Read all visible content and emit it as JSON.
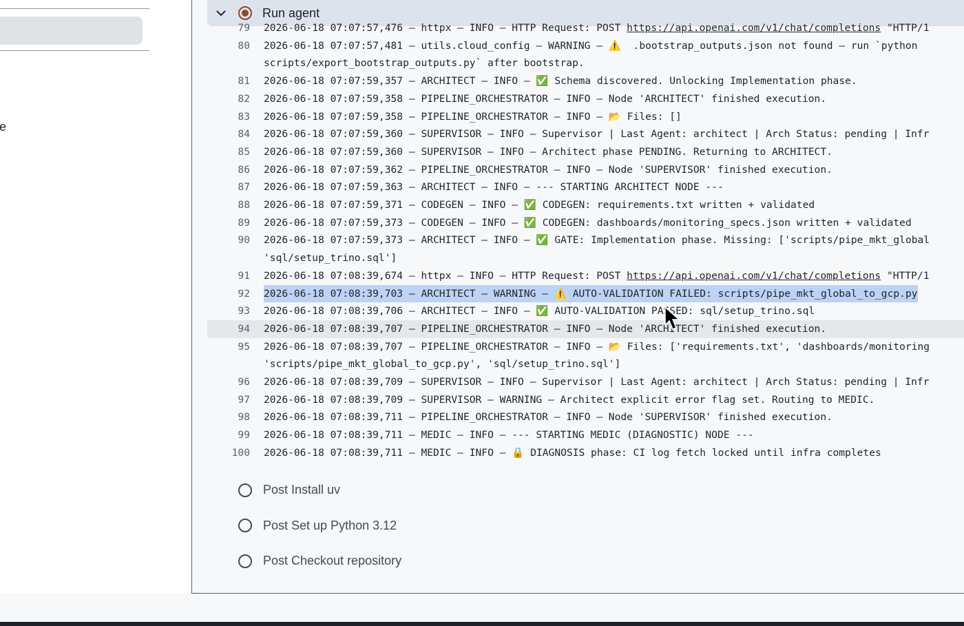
{
  "sidebar": {
    "fragment_text": "e"
  },
  "step": {
    "title": "Run agent",
    "status_icon": "running-icon",
    "chevron_icon": "chevron-down-icon"
  },
  "log": [
    {
      "n": "79",
      "parts": [
        {
          "t": "2026-06-18 07:07:57,476 – httpx – INFO – HTTP Request: POST "
        },
        {
          "t": "https://api.openai.com/v1/chat/completions",
          "link": true
        },
        {
          "t": " \"HTTP/1"
        }
      ]
    },
    {
      "n": "80",
      "parts": [
        {
          "t": "2026-06-18 07:07:57,481 – utils.cloud_config – WARNING – "
        },
        {
          "t": "⚠️",
          "emoji": true
        },
        {
          "t": "  .bootstrap_outputs.json not found – run `python"
        }
      ]
    },
    {
      "n": "",
      "wrap": true,
      "parts": [
        {
          "t": "scripts/export_bootstrap_outputs.py` after bootstrap."
        }
      ]
    },
    {
      "n": "81",
      "parts": [
        {
          "t": "2026-06-18 07:07:59,357 – ARCHITECT – INFO – "
        },
        {
          "t": "✅",
          "emoji": true
        },
        {
          "t": " Schema discovered. Unlocking Implementation phase."
        }
      ]
    },
    {
      "n": "82",
      "parts": [
        {
          "t": "2026-06-18 07:07:59,358 – PIPELINE_ORCHESTRATOR – INFO – Node 'ARCHITECT' finished execution."
        }
      ]
    },
    {
      "n": "83",
      "parts": [
        {
          "t": "2026-06-18 07:07:59,358 – PIPELINE_ORCHESTRATOR – INFO – "
        },
        {
          "t": "📂",
          "emoji": true
        },
        {
          "t": " Files: []"
        }
      ]
    },
    {
      "n": "84",
      "parts": [
        {
          "t": "2026-06-18 07:07:59,360 – SUPERVISOR – INFO – Supervisor | Last Agent: architect | Arch Status: pending | Infr"
        }
      ]
    },
    {
      "n": "85",
      "parts": [
        {
          "t": "2026-06-18 07:07:59,360 – SUPERVISOR – INFO – Architect phase PENDING. Returning to ARCHITECT."
        }
      ]
    },
    {
      "n": "86",
      "parts": [
        {
          "t": "2026-06-18 07:07:59,362 – PIPELINE_ORCHESTRATOR – INFO – Node 'SUPERVISOR' finished execution."
        }
      ]
    },
    {
      "n": "87",
      "parts": [
        {
          "t": "2026-06-18 07:07:59,363 – ARCHITECT – INFO – --- STARTING ARCHITECT NODE ---"
        }
      ]
    },
    {
      "n": "88",
      "parts": [
        {
          "t": "2026-06-18 07:07:59,371 – CODEGEN – INFO – "
        },
        {
          "t": "✅",
          "emoji": true
        },
        {
          "t": " CODEGEN: requirements.txt written + validated"
        }
      ]
    },
    {
      "n": "89",
      "parts": [
        {
          "t": "2026-06-18 07:07:59,373 – CODEGEN – INFO – "
        },
        {
          "t": "✅",
          "emoji": true
        },
        {
          "t": " CODEGEN: dashboards/monitoring_specs.json written + validated"
        }
      ]
    },
    {
      "n": "90",
      "parts": [
        {
          "t": "2026-06-18 07:07:59,373 – ARCHITECT – INFO – "
        },
        {
          "t": "✅",
          "emoji": true
        },
        {
          "t": " GATE: Implementation phase. Missing: ['scripts/pipe_mkt_global"
        }
      ]
    },
    {
      "n": "",
      "wrap": true,
      "parts": [
        {
          "t": "'sql/setup_trino.sql']"
        }
      ]
    },
    {
      "n": "91",
      "parts": [
        {
          "t": "2026-06-18 07:08:39,674 – httpx – INFO – HTTP Request: POST "
        },
        {
          "t": "https://api.openai.com/v1/chat/completions",
          "link": true
        },
        {
          "t": " \"HTTP/1"
        }
      ]
    },
    {
      "n": "92",
      "selected": true,
      "parts": [
        {
          "t": "2026-06-18 07:08:39,703 – ARCHITECT – WARNING – "
        },
        {
          "t": "⚠️",
          "emoji": true
        },
        {
          "t": " AUTO-VALIDATION FAILED: scripts/pipe_mkt_global_to_gcp.py"
        }
      ]
    },
    {
      "n": "93",
      "parts": [
        {
          "t": "2026-06-18 07:08:39,706 – ARCHITECT – INFO – "
        },
        {
          "t": "✅",
          "emoji": true
        },
        {
          "t": " AUTO-VALIDATION PASSED: sql/setup_trino.sql"
        }
      ]
    },
    {
      "n": "94",
      "hover": true,
      "parts": [
        {
          "t": "2026-06-18 07:08:39,707 – PIPELINE_ORCHESTRATOR – INFO – Node 'ARCHITECT' finished execution."
        }
      ]
    },
    {
      "n": "95",
      "parts": [
        {
          "t": "2026-06-18 07:08:39,707 – PIPELINE_ORCHESTRATOR – INFO – "
        },
        {
          "t": "📂",
          "emoji": true
        },
        {
          "t": " Files: ['requirements.txt', 'dashboards/monitoring"
        }
      ]
    },
    {
      "n": "",
      "wrap": true,
      "parts": [
        {
          "t": "'scripts/pipe_mkt_global_to_gcp.py', 'sql/setup_trino.sql']"
        }
      ]
    },
    {
      "n": "96",
      "parts": [
        {
          "t": "2026-06-18 07:08:39,709 – SUPERVISOR – INFO – Supervisor | Last Agent: architect | Arch Status: pending | Infr"
        }
      ]
    },
    {
      "n": "97",
      "parts": [
        {
          "t": "2026-06-18 07:08:39,709 – SUPERVISOR – WARNING – Architect explicit error flag set. Routing to MEDIC."
        }
      ]
    },
    {
      "n": "98",
      "parts": [
        {
          "t": "2026-06-18 07:08:39,711 – PIPELINE_ORCHESTRATOR – INFO – Node 'SUPERVISOR' finished execution."
        }
      ]
    },
    {
      "n": "99",
      "parts": [
        {
          "t": "2026-06-18 07:08:39,711 – MEDIC – INFO – --- STARTING MEDIC (DIAGNOSTIC) NODE ---"
        }
      ]
    },
    {
      "n": "100",
      "parts": [
        {
          "t": "2026-06-18 07:08:39,711 – MEDIC – INFO – "
        },
        {
          "t": "🔒",
          "emoji": true
        },
        {
          "t": " DIAGNOSIS phase: CI log fetch locked until infra completes"
        }
      ]
    }
  ],
  "post_steps": [
    {
      "label": "Post Install uv"
    },
    {
      "label": "Post Set up Python 3.12"
    },
    {
      "label": "Post Checkout repository"
    }
  ],
  "colors": {
    "selection": "#bcd3f5",
    "header_bg": "#dde3ea",
    "running": "#8a4b2a"
  }
}
